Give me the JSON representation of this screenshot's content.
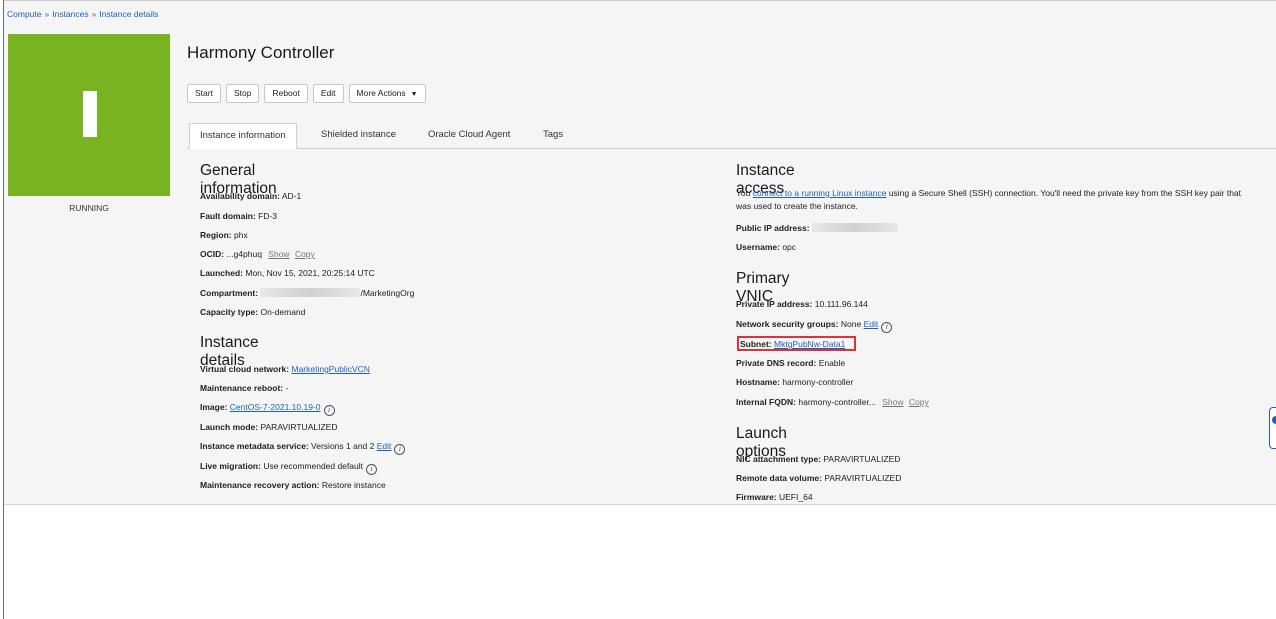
{
  "breadcrumb": {
    "item1": "Compute",
    "item2": "Instances",
    "current": "Instance details",
    "sep": "»"
  },
  "instance": {
    "badge_letter": "I",
    "state": "RUNNING",
    "title": "Harmony Controller"
  },
  "actions": {
    "start": "Start",
    "stop": "Stop",
    "reboot": "Reboot",
    "edit": "Edit",
    "more": "More Actions"
  },
  "tabs": [
    "Instance information",
    "Shielded instance",
    "Oracle Cloud Agent",
    "Tags"
  ],
  "general": {
    "heading": "General information",
    "availability_label": "Availability domain:",
    "availability_value": "AD-1",
    "fault_label": "Fault domain:",
    "fault_value": "FD-3",
    "region_label": "Region:",
    "region_value": "phx",
    "ocid_label": "OCID:",
    "ocid_value": "...g4phuq",
    "ocid_show": "Show",
    "ocid_copy": "Copy",
    "launched_label": "Launched:",
    "launched_value": "Mon, Nov 15, 2021, 20:25:14 UTC",
    "compartment_label": "Compartment:",
    "compartment_value": "/MarketingOrg",
    "capacity_label": "Capacity type:",
    "capacity_value": "On-demand"
  },
  "details": {
    "heading": "Instance details",
    "vcn_label": "Virtual cloud network:",
    "vcn_value": "MarketingPublicVCN",
    "maint_label": "Maintenance reboot:",
    "maint_value": "-",
    "image_label": "Image:",
    "image_value": "CentOS-7-2021.10.19-0",
    "launch_label": "Launch mode:",
    "launch_value": "PARAVIRTUALIZED",
    "metadata_label": "Instance metadata service:",
    "metadata_value": "Versions 1 and 2",
    "metadata_edit": "Edit",
    "migration_label": "Live migration:",
    "migration_value": "Use recommended default",
    "recovery_label": "Maintenance recovery action:",
    "recovery_value": "Restore instance"
  },
  "access": {
    "heading": "Instance access",
    "desc_pre": "You ",
    "desc_link": "connect to a running Linux instance",
    "desc_post": " using a Secure Shell (SSH) connection. You'll need the private key from the SSH key pair that",
    "desc_line2": "was used to create the instance.",
    "public_ip_label": "Public IP address:",
    "username_label": "Username:",
    "username_value": "opc"
  },
  "vnic": {
    "heading": "Primary VNIC",
    "private_ip_label": "Private IP address:",
    "private_ip_value": "10.111.96.144",
    "nsg_label": "Network security groups:",
    "nsg_value": "None",
    "nsg_edit": "Edit",
    "subnet_label": "Subnet:",
    "subnet_value": "MktgPubNw-Data1",
    "dns_label": "Private DNS record:",
    "dns_value": "Enable",
    "hostname_label": "Hostname:",
    "hostname_value": "harmony-controller",
    "fqdn_label": "Internal FQDN:",
    "fqdn_value": "harmony-controller...",
    "fqdn_show": "Show",
    "fqdn_copy": "Copy"
  },
  "launch": {
    "heading": "Launch options",
    "nic_label": "NIC attachment type:",
    "nic_value": "PARAVIRTUALIZED",
    "remote_label": "Remote data volume:",
    "remote_value": "PARAVIRTUALIZED",
    "firmware_label": "Firmware:",
    "firmware_value": "UEFI_64"
  },
  "info_glyph": "i",
  "colors": {
    "state_badge": "#78b321",
    "link": "#1f5fbf",
    "highlight": "#d9343b"
  }
}
